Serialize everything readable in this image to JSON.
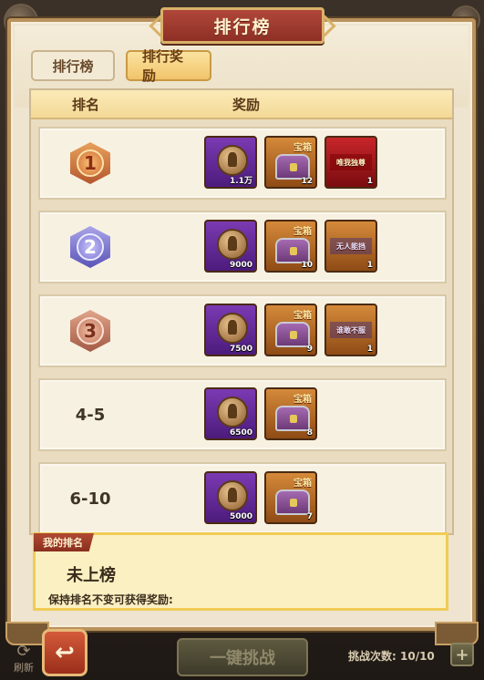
{
  "title": "排行榜",
  "tabs": [
    {
      "label": "排行榜",
      "active": false
    },
    {
      "label": "排行奖励",
      "active": true
    }
  ],
  "list_header": {
    "rank": "排名",
    "reward": "奖励"
  },
  "chest_label": "宝箱",
  "rows": [
    {
      "rank": "1",
      "medal": "gold",
      "rewards": [
        {
          "type": "coin",
          "count": "1.1万"
        },
        {
          "type": "chest",
          "count": "12"
        },
        {
          "type": "title",
          "label": "唯我独尊",
          "color": "red",
          "count": "1"
        }
      ]
    },
    {
      "rank": "2",
      "medal": "silver",
      "rewards": [
        {
          "type": "coin",
          "count": "9000"
        },
        {
          "type": "chest",
          "count": "10"
        },
        {
          "type": "title",
          "label": "无人能挡",
          "color": "orange",
          "count": "1"
        }
      ]
    },
    {
      "rank": "3",
      "medal": "bronze",
      "rewards": [
        {
          "type": "coin",
          "count": "7500"
        },
        {
          "type": "chest",
          "count": "9"
        },
        {
          "type": "title",
          "label": "谁敢不服",
          "color": "orange",
          "count": "1"
        }
      ]
    },
    {
      "rank": "4-5",
      "rewards": [
        {
          "type": "coin",
          "count": "6500"
        },
        {
          "type": "chest",
          "count": "8"
        }
      ]
    },
    {
      "rank": "6-10",
      "rewards": [
        {
          "type": "coin",
          "count": "5000"
        },
        {
          "type": "chest",
          "count": "7"
        }
      ]
    }
  ],
  "my_rank": {
    "tag": "我的排名",
    "value": "未上榜",
    "hint": "保持排名不变可获得奖励:"
  },
  "bottom": {
    "back_icon": "back-arrow-icon",
    "refresh_label": "刷新",
    "challenge_label": "一键挑战",
    "attempts_label": "挑战次数:",
    "attempts_value": "10/10",
    "plus": "+"
  }
}
